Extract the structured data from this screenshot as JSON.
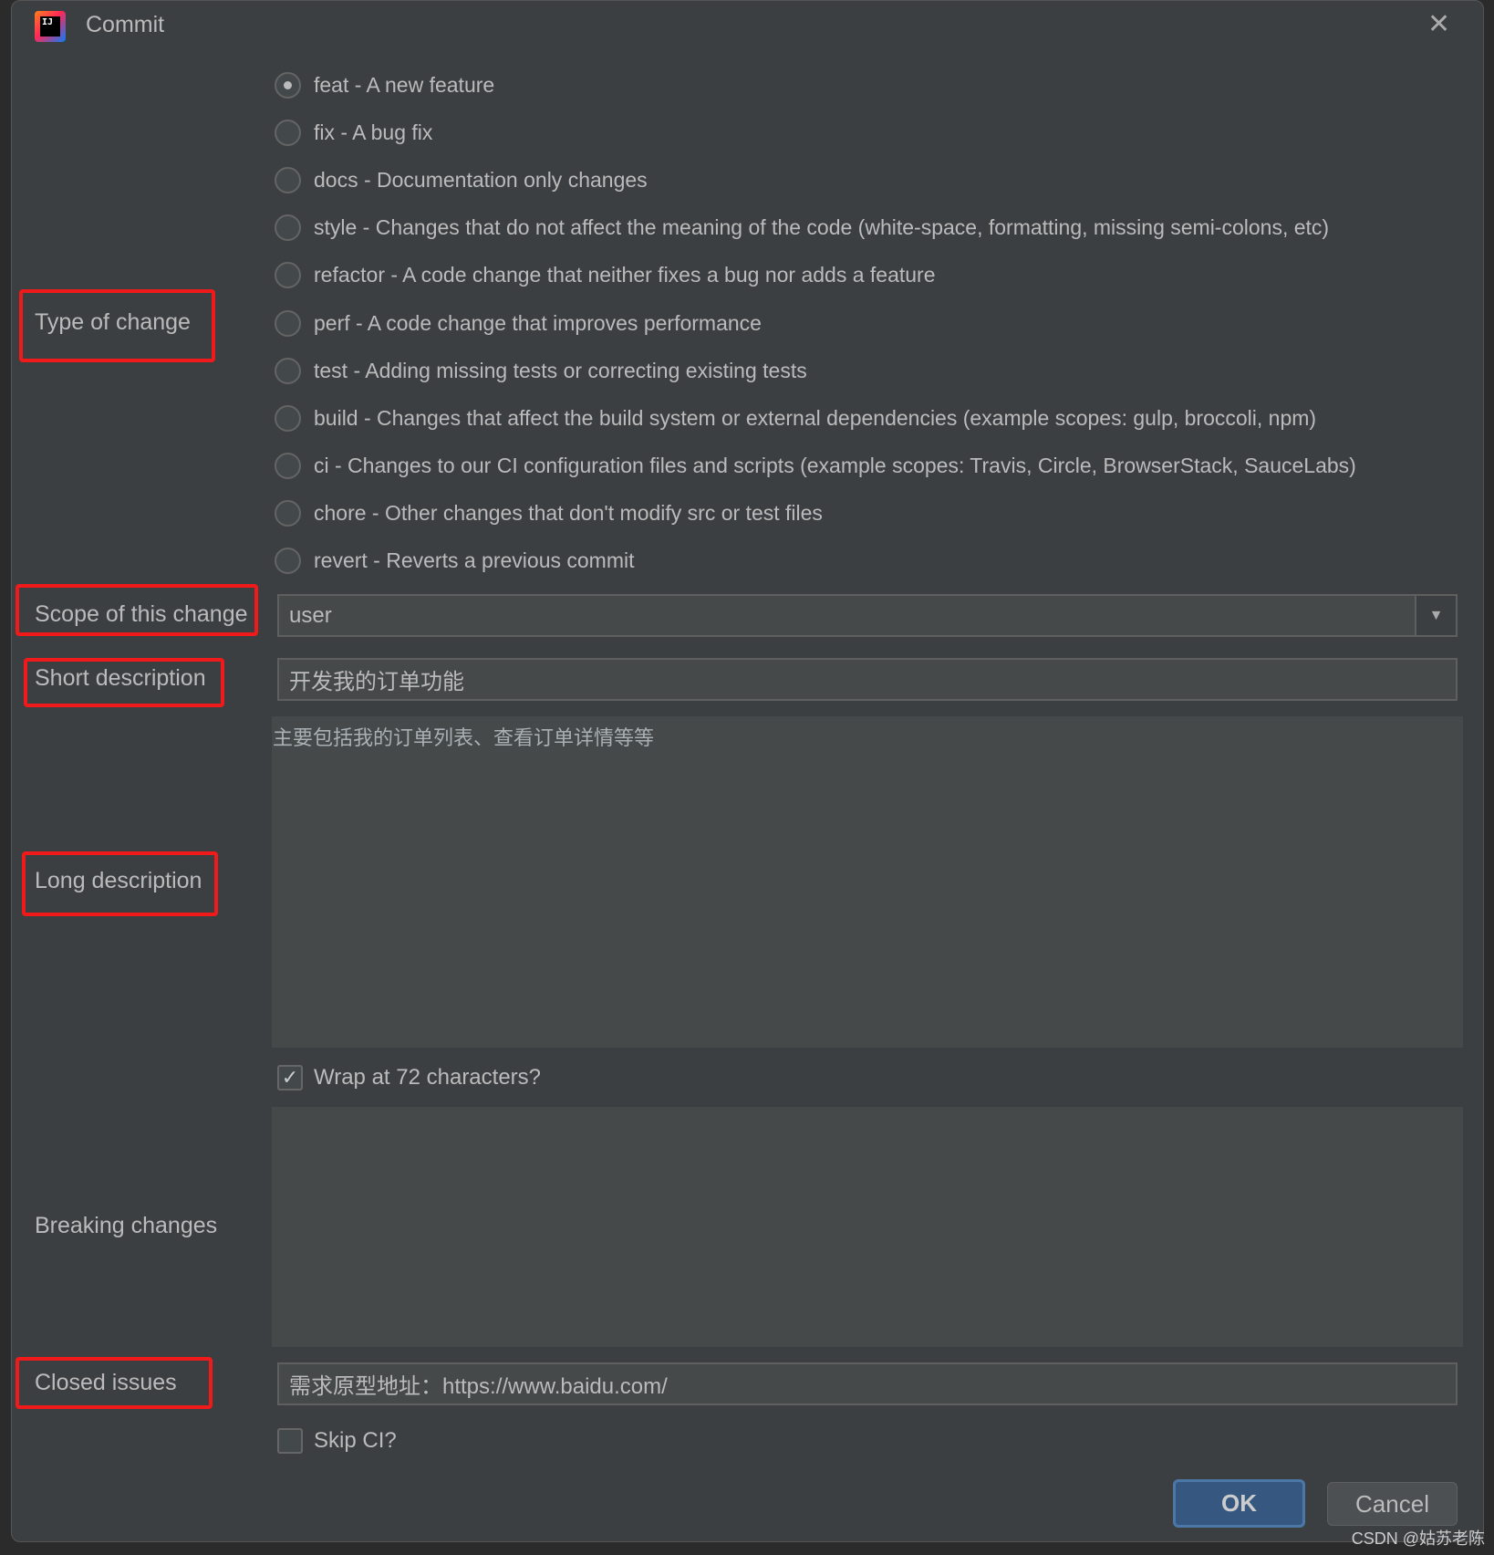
{
  "window": {
    "title": "Commit",
    "icon": "intellij-logo",
    "close_icon": "close-icon"
  },
  "labels": {
    "type": "Type of change",
    "scope": "Scope of this change",
    "short": "Short description",
    "long": "Long description",
    "breaking": "Breaking changes",
    "closed": "Closed issues"
  },
  "types": [
    {
      "label": "feat - A new feature",
      "selected": true
    },
    {
      "label": "fix - A bug fix"
    },
    {
      "label": "docs - Documentation only changes"
    },
    {
      "label": "style - Changes that do not affect the meaning of the code (white-space, formatting, missing semi-colons, etc)"
    },
    {
      "label": "refactor - A code change that neither fixes a bug nor adds a feature"
    },
    {
      "label": "perf - A code change that improves performance"
    },
    {
      "label": "test - Adding missing tests or correcting existing tests"
    },
    {
      "label": "build - Changes that affect the build system or external dependencies (example scopes: gulp, broccoli, npm)"
    },
    {
      "label": "ci - Changes to our CI configuration files and scripts (example scopes: Travis, Circle, BrowserStack, SauceLabs)"
    },
    {
      "label": "chore - Other changes that don't modify src or test files"
    },
    {
      "label": "revert - Reverts a previous commit"
    }
  ],
  "scope": {
    "value": "user"
  },
  "short_description": "开发我的订单功能",
  "long_description": "主要包括我的订单列表、查看订单详情等等",
  "wrap": {
    "label": "Wrap at 72 characters?",
    "checked": true
  },
  "breaking_changes": "",
  "closed_issues": "需求原型地址：https://www.baidu.com/",
  "skip_ci": {
    "label": "Skip CI?",
    "checked": false
  },
  "buttons": {
    "ok": "OK",
    "cancel": "Cancel"
  },
  "watermark": "CSDN @姑苏老陈",
  "colors": {
    "highlight": "#f01a1a",
    "accent": "#365880"
  }
}
